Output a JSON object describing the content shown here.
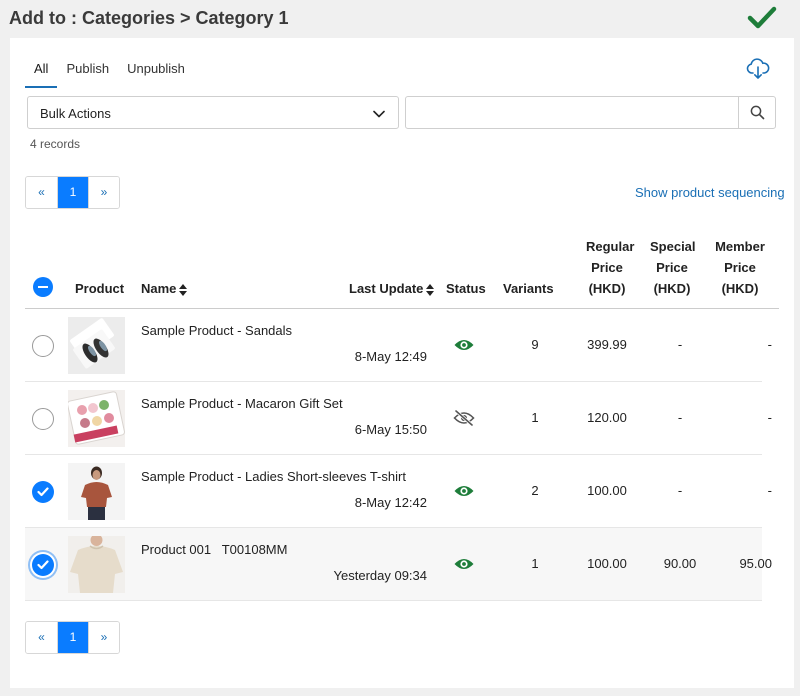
{
  "header": {
    "title": "Add to : Categories > Category 1",
    "confirm_icon": "checkmark-icon",
    "confirm_color": "#1e7d3a"
  },
  "tabs": [
    {
      "label": "All",
      "active": true
    },
    {
      "label": "Publish",
      "active": false
    },
    {
      "label": "Unpublish",
      "active": false
    }
  ],
  "toolbar": {
    "export_icon": "cloud-download-icon",
    "bulk_actions": {
      "selected": "Bulk Actions"
    },
    "search": {
      "value": "",
      "placeholder": "",
      "icon": "search-icon"
    }
  },
  "records_text": "4 records",
  "pagination": {
    "prev": "«",
    "current": "1",
    "next": "»"
  },
  "show_sequencing": "Show product sequencing",
  "table": {
    "columns": {
      "product": "Product",
      "name": "Name",
      "last_update": "Last Update",
      "status": "Status",
      "variants": "Variants",
      "regular_price": [
        "Regular",
        "Price",
        "(HKD)"
      ],
      "special_price": [
        "Special",
        "Price",
        "(HKD)"
      ],
      "member_price": [
        "Member",
        "Price",
        "(HKD)"
      ]
    },
    "rows": [
      {
        "name": "Sample Product - Sandals",
        "updated": "8-May 12:49",
        "published": true,
        "variants": "9",
        "regular": "399.99",
        "special": "-",
        "member": "-",
        "checked": false,
        "image": "sandals-photo"
      },
      {
        "name": "Sample Product - Macaron Gift Set",
        "updated": "6-May 15:50",
        "published": false,
        "variants": "1",
        "regular": "120.00",
        "special": "-",
        "member": "-",
        "checked": false,
        "image": "macaron-photo"
      },
      {
        "name": "Sample Product - Ladies Short-sleeves T-shirt",
        "updated": "8-May 12:42",
        "published": true,
        "variants": "2",
        "regular": "100.00",
        "special": "-",
        "member": "-",
        "checked": true,
        "image": "tshirt-model-photo"
      },
      {
        "name": "Product 001   T00108MM",
        "updated": "Yesterday 09:34",
        "published": true,
        "variants": "1",
        "regular": "100.00",
        "special": "90.00",
        "member": "95.00",
        "checked": true,
        "image": "tshirt-beige-photo"
      }
    ]
  },
  "colors": {
    "accent": "#0a7cff",
    "link": "#1a6fb5",
    "published": "#1e7d3a",
    "unpublished": "#555555"
  }
}
